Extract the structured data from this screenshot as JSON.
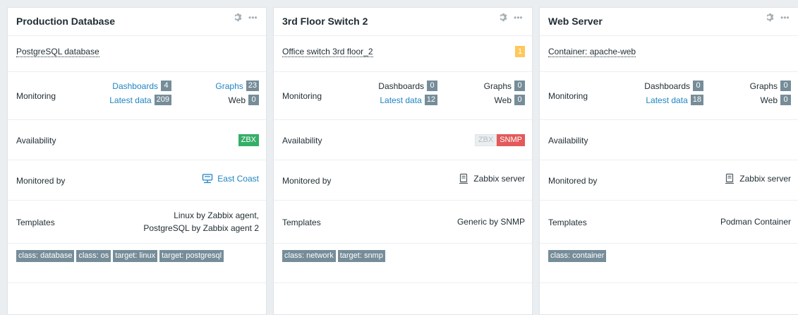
{
  "cards": [
    {
      "title": "Production Database",
      "description": "PostgreSQL database",
      "monitoring": {
        "dashboards_label": "Dashboards",
        "dashboards_count": "4",
        "graphs_label": "Graphs",
        "graphs_count": "23",
        "latest_label": "Latest data",
        "latest_count": "209",
        "web_label": "Web",
        "web_count": "0"
      },
      "availability": [
        "ZBX"
      ],
      "monitored_by": "East Coast",
      "templates": [
        "Linux by Zabbix agent,",
        "PostgreSQL by Zabbix agent 2"
      ],
      "tags": [
        "class: database",
        "class: os",
        "target: linux",
        "target: postgresql"
      ]
    },
    {
      "title": "3rd Floor Switch 2",
      "description": "Office switch 3rd floor_2",
      "problems": "1",
      "monitoring": {
        "dashboards_label": "Dashboards",
        "dashboards_count": "0",
        "graphs_label": "Graphs",
        "graphs_count": "0",
        "latest_label": "Latest data",
        "latest_count": "12",
        "web_label": "Web",
        "web_count": "0"
      },
      "availability": [
        "ZBX",
        "SNMP"
      ],
      "monitored_by": "Zabbix server",
      "templates": [
        "Generic by SNMP"
      ],
      "tags": [
        "class: network",
        "target: snmp"
      ]
    },
    {
      "title": "Web Server",
      "description": "Container: apache-web",
      "monitoring": {
        "dashboards_label": "Dashboards",
        "dashboards_count": "0",
        "graphs_label": "Graphs",
        "graphs_count": "0",
        "latest_label": "Latest data",
        "latest_count": "18",
        "web_label": "Web",
        "web_count": "0"
      },
      "availability": [],
      "monitored_by": "Zabbix server",
      "templates": [
        "Podman Container"
      ],
      "tags": [
        "class: container"
      ]
    }
  ],
  "labels": {
    "monitoring": "Monitoring",
    "availability": "Availability",
    "monitored_by": "Monitored by",
    "templates": "Templates"
  },
  "icons": {
    "settings": "gear-icon",
    "more": "more-dots-icon",
    "proxy": "proxy-icon",
    "server": "server-icon"
  },
  "colors": {
    "link": "#1f85c1",
    "count_badge": "#768d99",
    "zbx_available": "#34af67",
    "snmp_unavailable": "#e45959",
    "problem_warning": "#ffc859",
    "tag": "#768d99"
  }
}
